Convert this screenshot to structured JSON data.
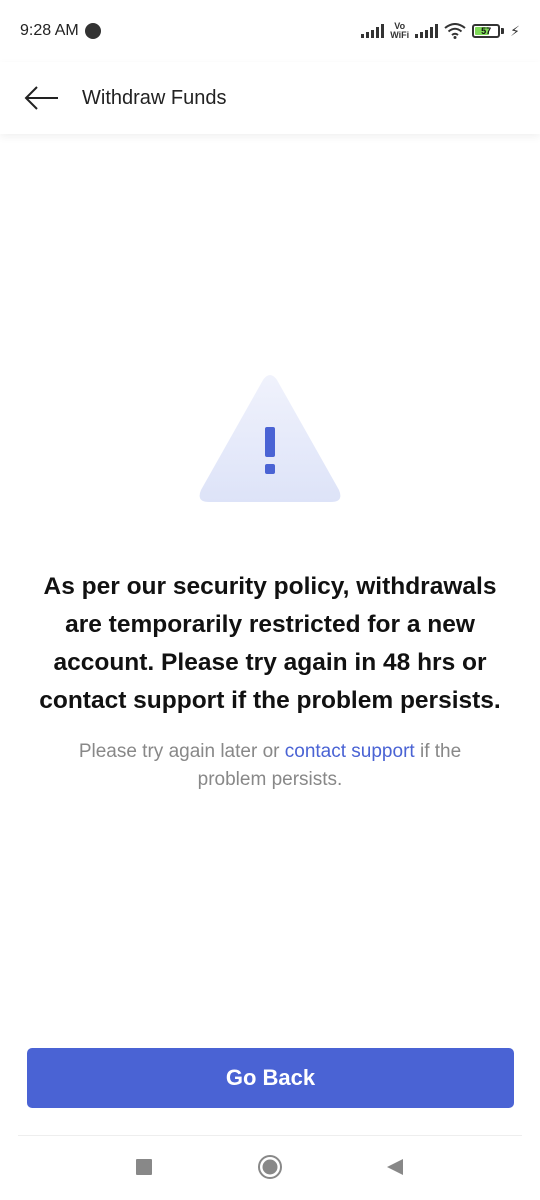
{
  "status_bar": {
    "time": "9:28 AM",
    "vowifi_top": "Vo",
    "vowifi_bottom": "WiFi",
    "battery_level": "57",
    "icons": [
      "record-dot-icon",
      "signal-icon",
      "vowifi-icon",
      "signal-icon",
      "wifi-icon",
      "battery-icon",
      "charging-bolt-icon"
    ]
  },
  "header": {
    "title": "Withdraw Funds",
    "back_icon": "arrow-left-icon"
  },
  "content": {
    "icon": "warning-triangle-icon",
    "message": "As per our security policy, withdrawals are temporarily restricted for a new account. Please try again in 48 hrs or contact support if the problem persists.",
    "sub_message_prefix": "Please try again later or ",
    "sub_message_link": "contact support",
    "sub_message_suffix": " if the problem persists."
  },
  "actions": {
    "go_back_label": "Go Back"
  },
  "colors": {
    "accent": "#4a63d4",
    "triangle_top": "#eef0fb",
    "triangle_bottom": "#dfe4f8"
  },
  "nav_bar": {
    "icons": [
      "square-recents-icon",
      "circle-home-icon",
      "triangle-back-icon"
    ]
  }
}
